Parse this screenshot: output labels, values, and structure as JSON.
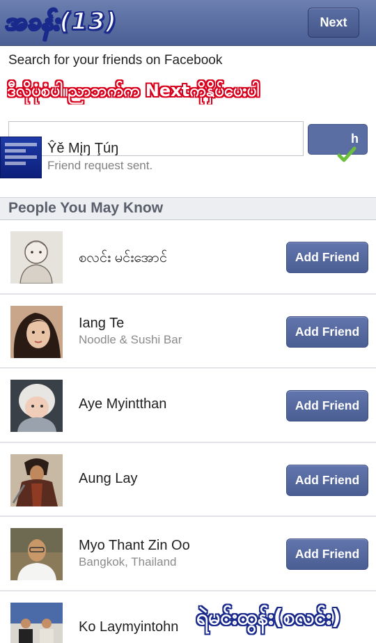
{
  "header": {
    "next_label": "Next",
    "overlay_title": "အခန်း(13)"
  },
  "search": {
    "label": "Search for your friends on Facebook",
    "placeholder": "",
    "overlay_instruction": "ဒီလိုပုံစံပါ။ညာဘက်က Nextကိုနှိပ်ပေးပါ"
  },
  "request_sent": {
    "name": "Ŷě Mįŋ Ţúŋ",
    "status": "Friend request sent."
  },
  "section": {
    "title": "People You May Know"
  },
  "people": [
    {
      "name": "စလင်း မင်းအောင်",
      "subtitle": "",
      "button": "Add Friend"
    },
    {
      "name": "Iang Te",
      "subtitle": "Noodle & Sushi Bar",
      "button": "Add Friend"
    },
    {
      "name": "Aye Myintthan",
      "subtitle": "",
      "button": "Add Friend"
    },
    {
      "name": "Aung Lay",
      "subtitle": "",
      "button": "Add Friend"
    },
    {
      "name": "Myo Thant Zin Oo",
      "subtitle": "Bangkok, Thailand",
      "button": "Add Friend"
    },
    {
      "name": "Ko Laymyintohn",
      "subtitle": "",
      "button": ""
    }
  ],
  "overlay_credit": "ရဲမင်းထွန်း(စလင်း)",
  "colors": {
    "brand_blue": "#4b5f95",
    "button_blue": "#5a6ea3",
    "check_green": "#6cbf3d"
  }
}
